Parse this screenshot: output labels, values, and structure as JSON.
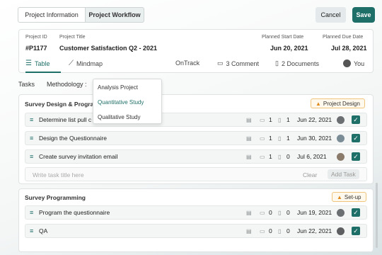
{
  "header": {
    "tab_info": "Project Information",
    "tab_workflow": "Project Workflow",
    "cancel": "Cancel",
    "save": "Save"
  },
  "project": {
    "id_label": "Project ID",
    "title_label": "Project Title",
    "start_label": "Planned Start Date",
    "due_label": "Planned Due Date",
    "id": "#P1177",
    "title": "Customer Satisfaction Q2 - 2021",
    "start": "Jun 20, 2021",
    "due": "Jul 28, 2021"
  },
  "nav": {
    "table": "Table",
    "mindmap": "Mindmap",
    "status": "OnTrack",
    "comments": "3 Comment",
    "documents": "2 Documents",
    "user": "You"
  },
  "filters": {
    "tasks": "Tasks",
    "methodology": "Methodology :"
  },
  "dropdown": {
    "options": [
      "Analysis Project",
      "Quantitative Study",
      "Qualitative Study"
    ],
    "selected_index": 1
  },
  "sections": [
    {
      "title": "Survey Design & Progra",
      "badge": "Project Design",
      "tasks": [
        {
          "title": "Determine list pull c",
          "comments": "1",
          "docs": "1",
          "date": "Jun 22, 2021"
        },
        {
          "title": "Design the Questionnaire",
          "comments": "1",
          "docs": "1",
          "date": "Jun 30, 2021"
        },
        {
          "title": "Create survey invitation email",
          "comments": "1",
          "docs": "0",
          "date": "Jul 6, 2021"
        }
      ],
      "add_placeholder": "Write task title here",
      "clear": "Clear",
      "add_task": "Add Task"
    },
    {
      "title": "Survey Programming",
      "badge": "Set-up",
      "tasks": [
        {
          "title": "Program the questionnaire",
          "comments": "0",
          "docs": "0",
          "date": "Jun 19, 2021"
        },
        {
          "title": "QA",
          "comments": "0",
          "docs": "0",
          "date": "Jun 22, 2021"
        }
      ]
    }
  ],
  "colors": {
    "accent": "#1f6f69",
    "badge_border": "#f0c47a"
  }
}
